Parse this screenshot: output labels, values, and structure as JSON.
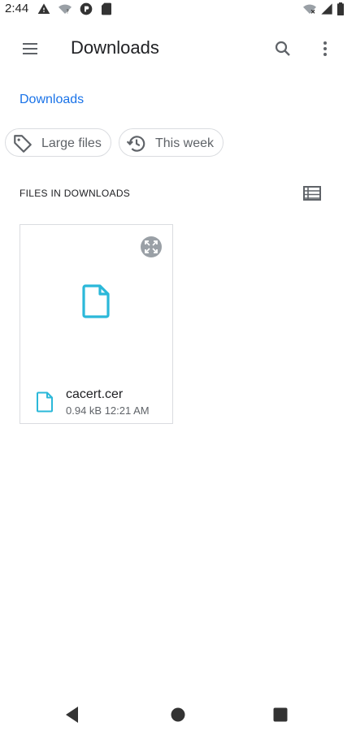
{
  "status_bar": {
    "time": "2:44",
    "left_icons": [
      "warning-icon",
      "wifi-question-icon",
      "app-notification-icon",
      "sd-card-icon"
    ],
    "right_icons": [
      "wifi-off-icon",
      "signal-icon",
      "battery-icon"
    ]
  },
  "app_bar": {
    "title": "Downloads",
    "menu_icon": "hamburger-menu-icon",
    "search_icon": "search-icon",
    "more_icon": "more-vert-icon"
  },
  "breadcrumb": {
    "label": "Downloads"
  },
  "chips": [
    {
      "label": "Large files",
      "icon": "tag-icon"
    },
    {
      "label": "This week",
      "icon": "history-icon"
    }
  ],
  "section": {
    "header": "FILES IN DOWNLOADS",
    "view_toggle_icon": "list-view-icon"
  },
  "files": [
    {
      "name": "cacert.cer",
      "meta": "0.94 kB 12:21 AM",
      "icon": "document-icon"
    }
  ],
  "colors": {
    "accent": "#1a73e8",
    "file_icon": "#2bb8d9",
    "text_primary": "#202124",
    "text_secondary": "#5f6368",
    "border": "#dadce0"
  },
  "nav_bar": {
    "back_icon": "back-icon",
    "home_icon": "home-icon",
    "recents_icon": "recents-icon"
  }
}
